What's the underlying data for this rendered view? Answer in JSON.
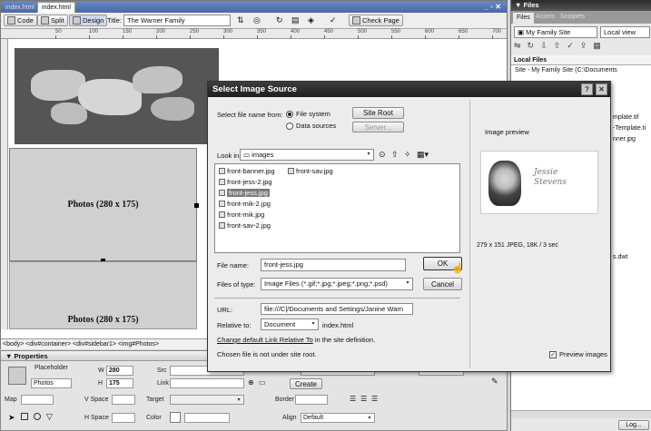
{
  "doc_tabs": [
    "index.html",
    "index.html"
  ],
  "doc_window_controls": "_ ▫ ✕",
  "toolbar": {
    "code": "Code",
    "split": "Split",
    "design": "Design",
    "title_label": "Title:",
    "title_value": "The Warner Family",
    "check_page": "Check Page"
  },
  "ruler_ticks": [
    "50",
    "100",
    "150",
    "200",
    "250",
    "300",
    "350",
    "400",
    "450",
    "500",
    "550",
    "600",
    "650",
    "700"
  ],
  "canvas": {
    "photo_box_1": "Photos (280 x 175)",
    "photo_box_2": "Photos (280 x 175)"
  },
  "tag_selector": "<body> <div#container> <div#sidebar1> <img#Photos>",
  "properties": {
    "header": "Properties",
    "placeholder_label": "Placeholder",
    "w_label": "W",
    "w_value": "280",
    "h_label": "H",
    "h_value": "175",
    "name_value": "Photos",
    "src_label": "Src",
    "link_label": "Link",
    "alt_label": "Alt",
    "alt_value": "Photos",
    "class_label": "Class",
    "class_value": "None",
    "create_button": "Create",
    "map_label": "Map",
    "vspace_label": "V Space",
    "hspace_label": "H Space",
    "target_label": "Target",
    "border_label": "Border",
    "color_label": "Color",
    "align_label": "Align",
    "align_value": "Default"
  },
  "files_panel": {
    "header": "Files",
    "tabs": [
      "Files",
      "Assets",
      "Snippets"
    ],
    "site_value": "My Family Site",
    "view_value": "Local view",
    "local_files_header": "Local Files",
    "site_row": "Site - My Family Site (C:\\Documents",
    "partial_items": [
      "mplate.tif",
      "-Template.ti",
      "nner.jpg",
      "s.dwt"
    ],
    "log_button": "Log..."
  },
  "dialog": {
    "title": "Select Image Source",
    "select_from_label": "Select file name from:",
    "file_system": "File system",
    "data_sources": "Data sources",
    "site_root_button": "Site Root",
    "server_button": "Server...",
    "look_in_label": "Look in:",
    "look_in_value": "images",
    "files": [
      "front-banner.jpg",
      "front-jess-2.jpg",
      "front-jess.jpg",
      "front-mik-2.jpg",
      "front-mik.jpg",
      "front-sav-2.jpg",
      "front-sav.jpg"
    ],
    "selected_file": "front-jess.jpg",
    "file_name_label": "File name:",
    "file_name_value": "front-jess.jpg",
    "ok_button": "OK",
    "files_of_type_label": "Files of type:",
    "files_of_type_value": "Image Files (*.gif;*.jpg;*.jpeg;*.png;*.psd)",
    "cancel_button": "Cancel",
    "url_label": "URL:",
    "url_value": "file:///C|/Documents and Settings/Janine Warn",
    "relative_to_label": "Relative to:",
    "relative_to_value": "Document",
    "relative_to_file": "index.html",
    "change_default_link": "Change default Link Relative To",
    "change_default_rest": "in the site definition.",
    "not_under_root": "Chosen file is not under site root.",
    "image_preview_label": "Image preview",
    "preview_caption": "Jessie Stevens",
    "image_info": "279 x 151 JPEG, 18K / 3 sec",
    "preview_images_label": "Preview images"
  }
}
